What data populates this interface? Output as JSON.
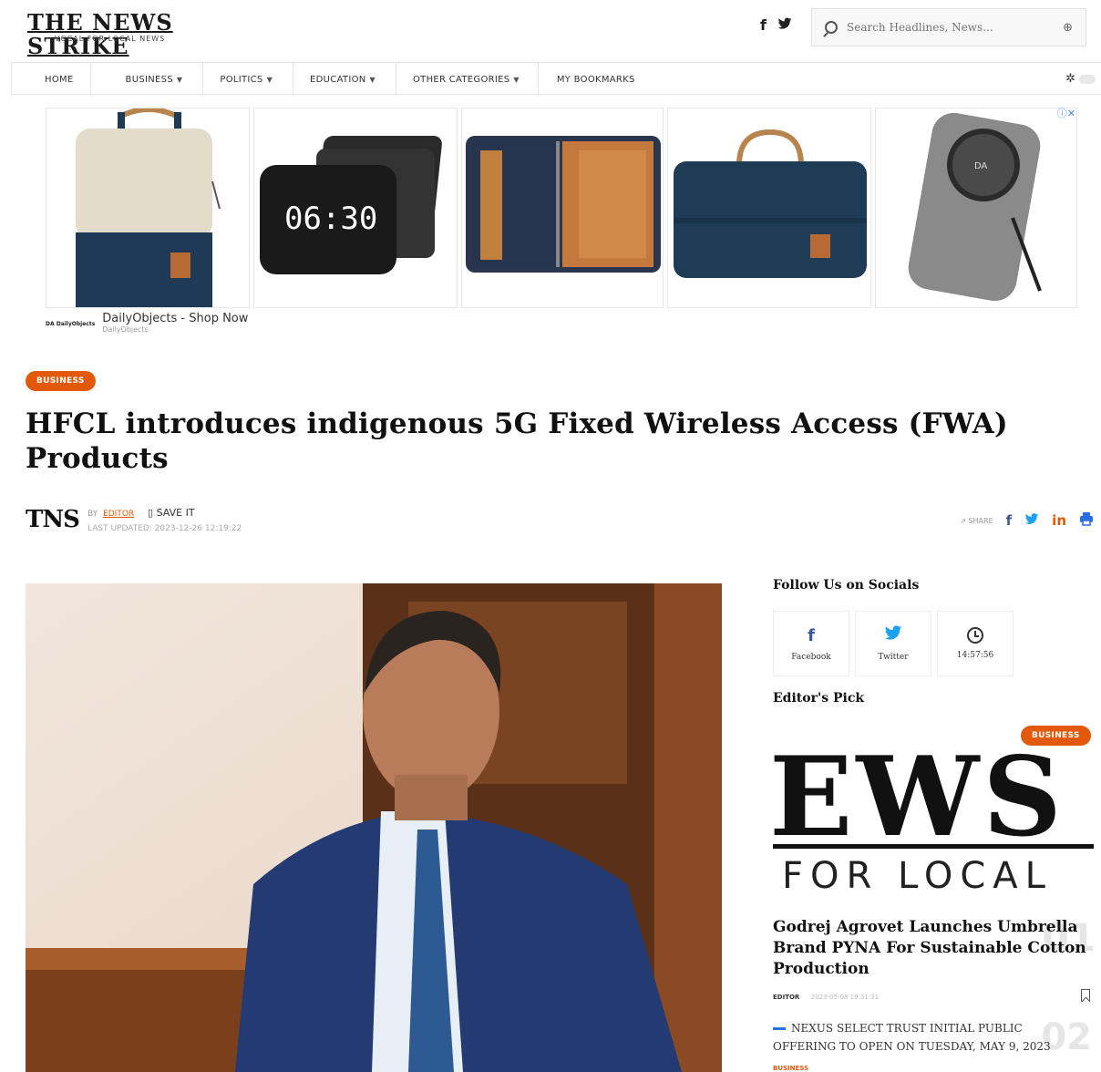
{
  "header": {
    "logo_text": "THE NEWS STRIKE",
    "logo_tagline": "VOCAL FOR LOCAL NEWS",
    "search_placeholder": "Search Headlines, News...",
    "search_icon": "search-icon",
    "social": [
      {
        "icon": "facebook-icon",
        "glyph": "f"
      },
      {
        "icon": "twitter-icon",
        "glyph": "🐦"
      }
    ]
  },
  "nav": {
    "items": [
      {
        "label": "HOME",
        "dropdown": false
      },
      {
        "label": "BUSINESS",
        "dropdown": true
      },
      {
        "label": "POLITICS",
        "dropdown": true
      },
      {
        "label": "EDUCATION",
        "dropdown": true
      },
      {
        "label": "OTHER CATEGORIES",
        "dropdown": true
      },
      {
        "label": "MY BOOKMARKS",
        "dropdown": false
      }
    ],
    "theme_toggle_icon": "sun-icon"
  },
  "ad": {
    "products": [
      "backpack",
      "clock-dock",
      "organizer-case",
      "laptop-bag",
      "power-bank"
    ],
    "clock_time": "06:30",
    "brand": "DailyObjects - Shop Now",
    "brand_sub": "DailyObjects",
    "logo_text": "DA DailyObjects",
    "powerbank_logo": "DA"
  },
  "article": {
    "category": "BUSINESS",
    "title": "HFCL introduces indigenous 5G Fixed Wireless Access (FWA) Products",
    "byline_logo": "TNS",
    "by": "BY",
    "author": "EDITOR",
    "save_label": "SAVE IT",
    "updated": "LAST UPDATED: 2023-12-26 12:19:22",
    "share_label": "SHARE"
  },
  "sidebar": {
    "follow_title": "Follow Us on Socials",
    "socials": [
      {
        "icon": "facebook-icon",
        "label": "Facebook",
        "color": "#3b5998"
      },
      {
        "icon": "twitter-icon",
        "label": "Twitter",
        "color": "#1da1f2"
      },
      {
        "icon": "clock-icon",
        "label": "14:57:56",
        "color": "#333333"
      }
    ],
    "editors_pick_title": "Editor's Pick",
    "pick": {
      "image_text_top": "EWS S",
      "image_text_bottom": "FOR LOCAL",
      "category": "BUSINESS",
      "title": "Godrej Agrovet Launches Umbrella Brand PYNA For Sustainable Cotton Production",
      "author": "EDITOR",
      "date": "2023-05-08 19:31:31",
      "number": "01"
    },
    "second": {
      "title": "NEXUS SELECT TRUST INITIAL PUBLIC OFFERING TO OPEN ON TUESDAY, MAY 9, 2023",
      "number": "02",
      "category": "BUSINESS"
    }
  },
  "colors": {
    "accent": "#e2590c",
    "facebook": "#3b5998",
    "twitter": "#1da1f2",
    "linkedin": "#e2590c",
    "print": "#2a6ee6"
  }
}
